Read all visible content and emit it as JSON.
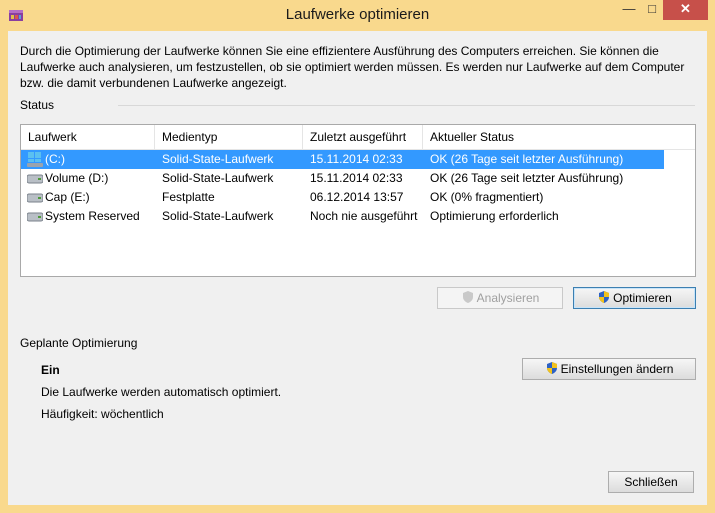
{
  "window": {
    "title": "Laufwerke optimieren",
    "min_glyph": "—",
    "max_glyph": "□",
    "close_glyph": "✕"
  },
  "intro": "Durch die Optimierung der Laufwerke können Sie eine effizientere Ausführung des Computers erreichen. Sie können die Laufwerke auch analysieren, um festzustellen, ob sie optimiert werden müssen. Es werden nur Laufwerke auf dem Computer bzw. die damit verbundenen Laufwerke angezeigt.",
  "status": {
    "label": "Status",
    "columns": [
      "Laufwerk",
      "Medientyp",
      "Zuletzt ausgeführt",
      "Aktueller Status"
    ],
    "rows": [
      {
        "drive": "(C:)",
        "media": "Solid-State-Laufwerk",
        "last": "15.11.2014 02:33",
        "state": "OK (26 Tage seit letzter Ausführung)",
        "icon": "windows-drive-icon",
        "selected": true
      },
      {
        "drive": "Volume (D:)",
        "media": "Solid-State-Laufwerk",
        "last": "15.11.2014 02:33",
        "state": "OK (26 Tage seit letzter Ausführung)",
        "icon": "drive-icon",
        "selected": false
      },
      {
        "drive": "Cap (E:)",
        "media": "Festplatte",
        "last": "06.12.2014 13:57",
        "state": "OK (0% fragmentiert)",
        "icon": "drive-icon",
        "selected": false
      },
      {
        "drive": "System Reserved",
        "media": "Solid-State-Laufwerk",
        "last": "Noch nie ausgeführt",
        "state": "Optimierung erforderlich",
        "icon": "drive-icon",
        "selected": false
      }
    ],
    "analyze_label": "Analysieren",
    "optimize_label": "Optimieren"
  },
  "schedule": {
    "label": "Geplante Optimierung",
    "state": "Ein",
    "description": "Die Laufwerke werden automatisch optimiert.",
    "frequency": "Häufigkeit: wöchentlich",
    "settings_label": "Einstellungen ändern"
  },
  "close_label": "Schließen",
  "colors": {
    "titlebar": "#f9d98d",
    "selection": "#3399ff",
    "close": "#c7504a"
  }
}
